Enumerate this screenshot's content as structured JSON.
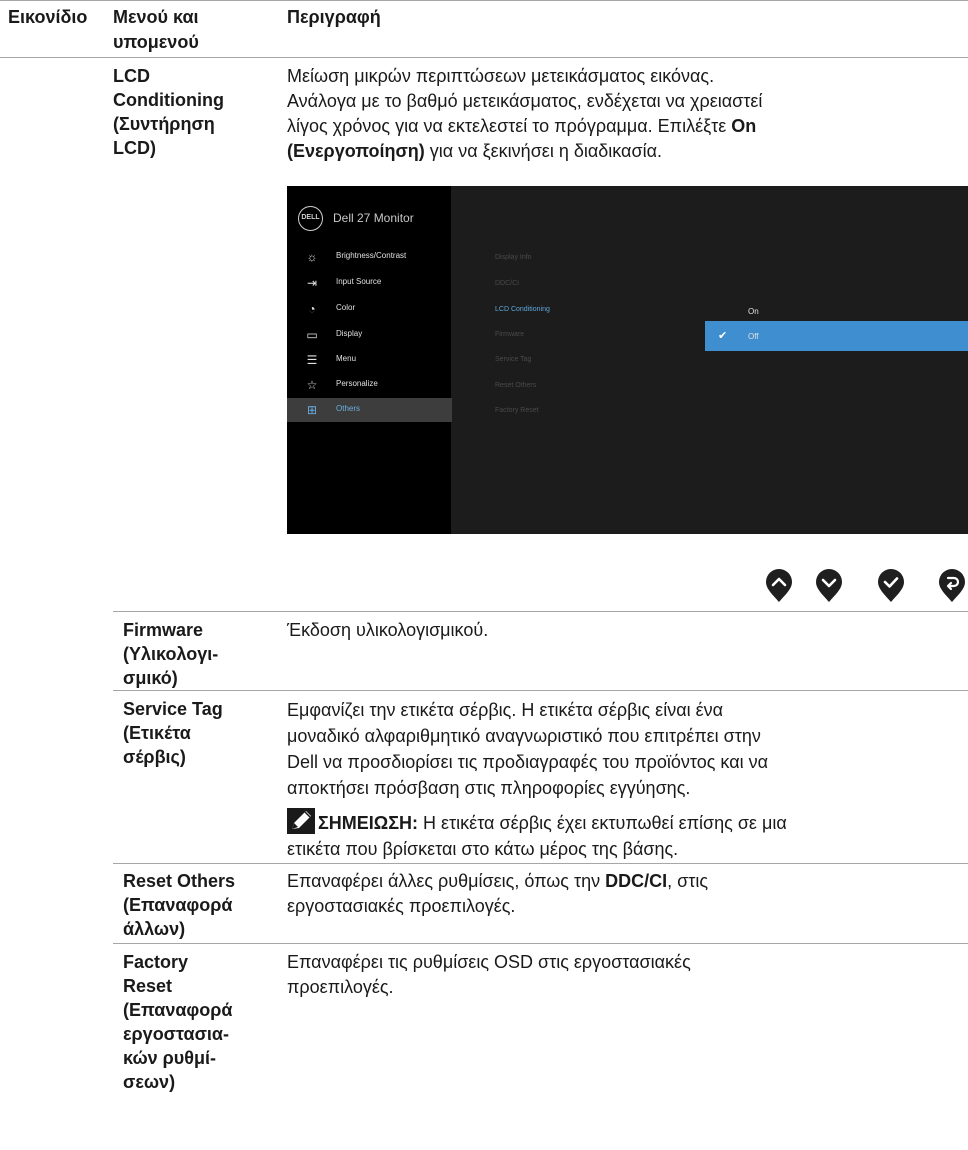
{
  "table": {
    "headers": {
      "icon": "Εικονίδιο",
      "menu": "Μενού και υπομενού",
      "desc": "Περιγραφή"
    },
    "rows": {
      "lcd": {
        "term": [
          "LCD",
          "Conditioning",
          "(Συντήρηση",
          "LCD)"
        ],
        "desc": [
          "Μείωση μικρών περιπτώσεων μετεικάσματος εικόνας.",
          "Ανάλογα με το βαθμό μετεικάσματος, ενδέχεται να χρειαστεί",
          "λίγος χρόνος για να εκτελεστεί το πρόγραμμα. Επιλέξτε ",
          "On",
          "(Ενεργοποίηση)",
          " για να ξεκινήσει η διαδικασία."
        ]
      },
      "firmware": {
        "term": [
          "Firmware",
          "(Υλικολογι-",
          "σμικό)"
        ],
        "desc": "Έκδοση υλικολογισμικού."
      },
      "service_tag": {
        "term": [
          "Service Tag",
          "(Ετικέτα",
          "σέρβις)"
        ],
        "desc": [
          "Εμφανίζει την ετικέτα σέρβις. Η ετικέτα σέρβις είναι ένα",
          "μοναδικό αλφαριθμητικό αναγνωριστικό που επιτρέπει στην",
          "Dell να προσδιορίσει τις προδιαγραφές του προϊόντος και να",
          "αποκτήσει πρόσβαση στις πληροφορίες εγγύησης."
        ],
        "note_label": "ΣΗΜΕΙΩΣΗ:",
        "note_text": [
          " Η ετικέτα σέρβις έχει εκτυπωθεί επίσης σε μια",
          "ετικέτα που βρίσκεται στο κάτω μέρος της βάσης."
        ]
      },
      "reset_others": {
        "term": [
          "Reset Others",
          "(Επαναφορά",
          "άλλων)"
        ],
        "desc": [
          "Επαναφέρει άλλες ρυθμίσεις, όπως την ",
          "DDC/CI",
          ", στις",
          "εργοστασιακές προεπιλογές."
        ]
      },
      "factory_reset": {
        "term": [
          "Factory",
          "Reset",
          "(Επαναφορά",
          "εργοστασια-",
          "κών ρυθμί-",
          "σεων)"
        ],
        "desc": [
          "Επαναφέρει τις ρυθμίσεις OSD στις εργοστασιακές",
          "προεπιλογές."
        ]
      }
    }
  },
  "osd": {
    "logo": "DELL",
    "title": "Dell 27 Monitor",
    "menu": [
      {
        "label": "Brightness/Contrast",
        "icon": "sun-icon"
      },
      {
        "label": "Input Source",
        "icon": "input-icon"
      },
      {
        "label": "Color",
        "icon": "palette-icon"
      },
      {
        "label": "Display",
        "icon": "display-icon"
      },
      {
        "label": "Menu",
        "icon": "menu-icon"
      },
      {
        "label": "Personalize",
        "icon": "star-icon"
      },
      {
        "label": "Others",
        "icon": "others-icon"
      }
    ],
    "active_menu": "Others",
    "submenu": [
      "Display Info",
      "DDC/CI",
      "LCD Conditioning",
      "Firmware",
      "Service Tag",
      "Reset Others",
      "Factory Reset"
    ],
    "selected_submenu": "LCD Conditioning",
    "options": [
      "On",
      "Off"
    ],
    "checked_option": "Off",
    "colors": {
      "accent": "#3e8ed0",
      "highlight_text": "#5fa7dd"
    }
  },
  "nav_buttons": [
    "up-button-icon",
    "down-button-icon",
    "check-button-icon",
    "back-button-icon"
  ]
}
